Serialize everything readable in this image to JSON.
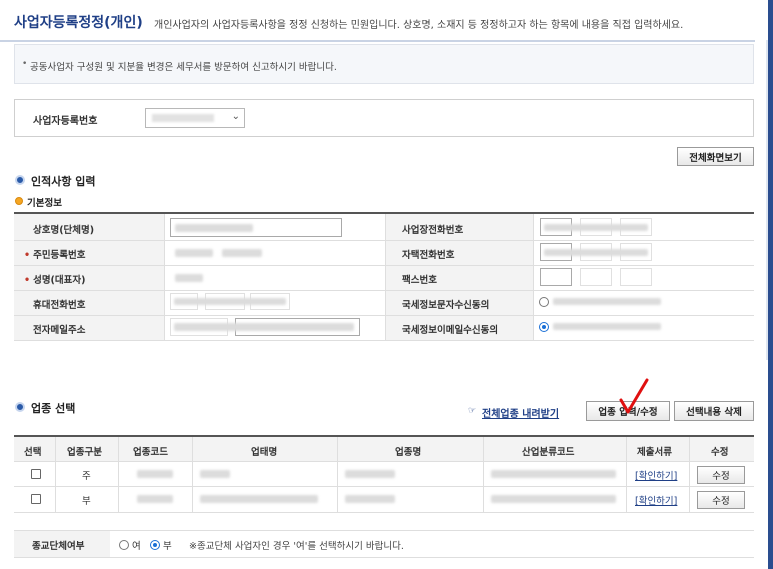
{
  "page": {
    "title": "사업자등록정정(개인)",
    "description": "개인사업자의 사업자등록사항을 정정 신청하는 민원입니다. 상호명, 소재지 등 정정하고자 하는 항목에 내용을 직접 입력하세요.",
    "notice": "공동사업자 구성원 및 지분율 변경은 세무서를 방문하여 신고하시기 바랍니다."
  },
  "business_number": {
    "label": "사업자등록번호"
  },
  "buttons": {
    "full_screen": "전체화면보기"
  },
  "personal": {
    "section_title": "인적사항 입력",
    "subsection_title": "기본정보",
    "fields": {
      "trade_name": "상호명(단체명)",
      "resident_number": "주민등록번호",
      "name": "성명(대표자)",
      "mobile": "휴대전화번호",
      "email": "전자메일주소",
      "office_phone": "사업장전화번호",
      "home_phone": "자택전화번호",
      "fax": "팩스번호",
      "sms_consent": "국세정보문자수신동의",
      "email_consent": "국세정보이메일수신동의"
    }
  },
  "industry": {
    "section_title": "업종 선택",
    "download_link": "전체업종 내려받기",
    "input_button": "업종 입력/수정",
    "delete_button": "선택내용 삭제",
    "columns": [
      "선택",
      "업종구분",
      "업종코드",
      "업태명",
      "업종명",
      "산업분류코드",
      "제출서류",
      "수정"
    ],
    "rows": [
      {
        "type": "주",
        "docs_link": "[확인하기]",
        "edit_label": "수정"
      },
      {
        "type": "부",
        "docs_link": "[확인하기]",
        "edit_label": "수정"
      }
    ]
  },
  "religious": {
    "label": "종교단체여부",
    "option_yes": "여",
    "option_no": "부",
    "note": "※종교단체 사업자인 경우 '여'를 선택하시기 바랍니다."
  },
  "annotation": {
    "mark": "✓",
    "color": "#e01010"
  },
  "colors": {
    "title": "#1f3f86",
    "link": "#1f3f86",
    "required": "#c0392b"
  }
}
